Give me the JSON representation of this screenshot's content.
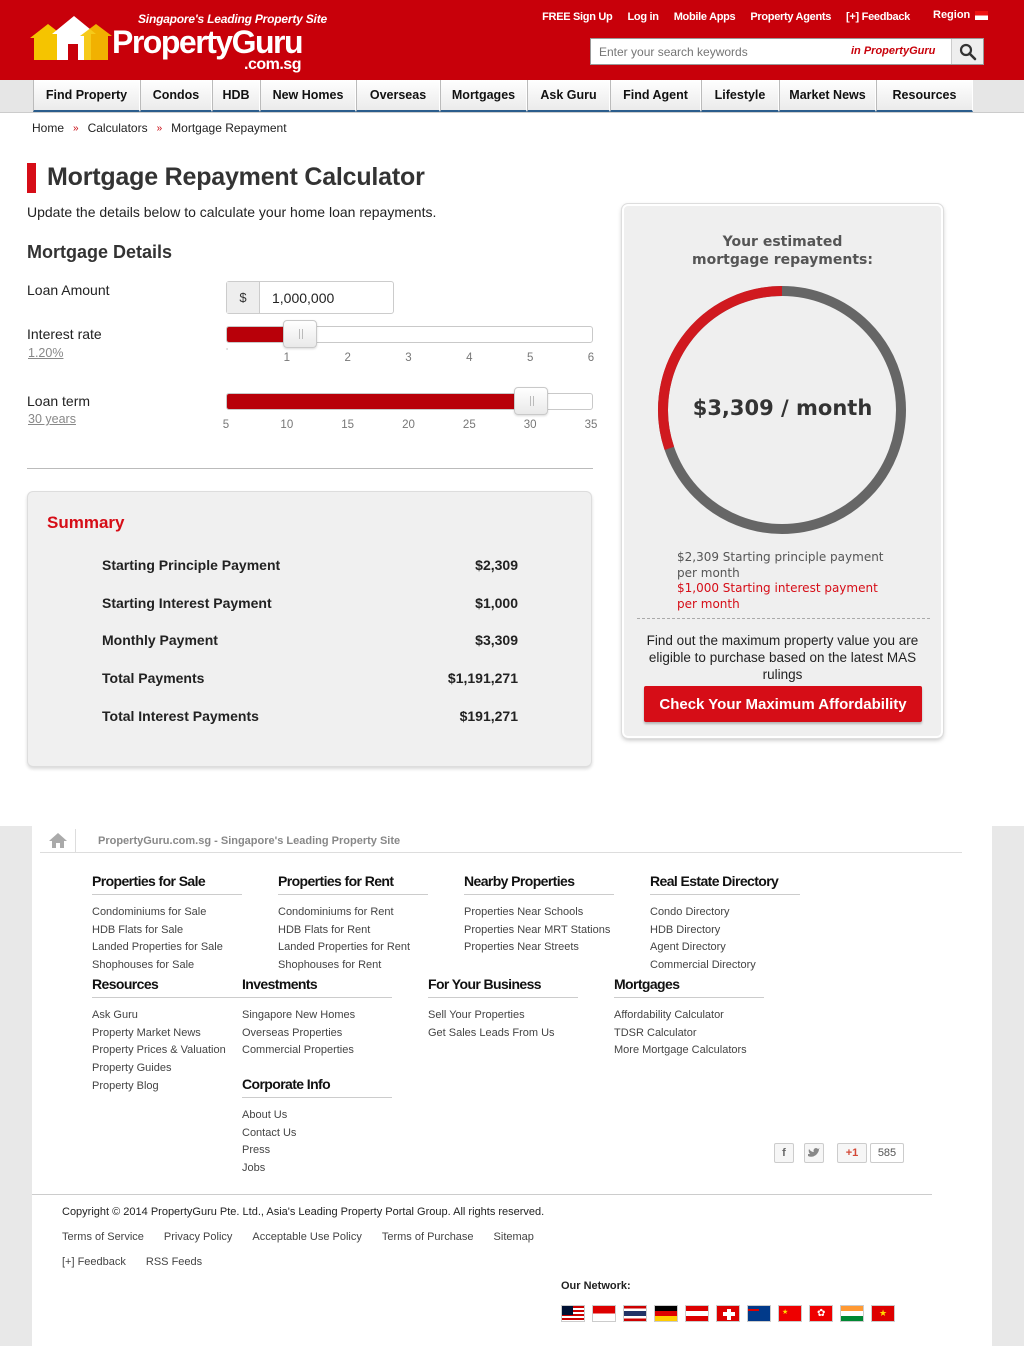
{
  "header": {
    "tagline": "Singapore's Leading Property Site",
    "brand_property": "Property",
    "brand_guru": "Guru",
    "brand_sub": ".com.sg",
    "links": [
      "FREE Sign Up",
      "Log in",
      "Mobile Apps",
      "Property Agents",
      "[+] Feedback"
    ],
    "region": "Region",
    "search_placeholder": "Enter your search keywords",
    "search_scope": "in PropertyGuru"
  },
  "nav": [
    "Find Property",
    "Condos",
    "HDB",
    "New Homes",
    "Overseas",
    "Mortgages",
    "Ask Guru",
    "Find Agent",
    "Lifestyle",
    "Market News",
    "Resources"
  ],
  "breadcrumb": [
    "Home",
    "Calculators",
    "Mortgage Repayment"
  ],
  "breadcrumb_sep": "»",
  "page": {
    "title": "Mortgage Repayment Calculator",
    "subtitle": "Update the details below to calculate your home loan repayments.",
    "section": "Mortgage Details"
  },
  "form": {
    "loan_amount_label": "Loan Amount",
    "currency": "$",
    "loan_amount_value": "1,000,000",
    "interest_label": "Interest rate",
    "interest_value_text": "1.20%",
    "interest_rate": 1.2,
    "interest_ticks": [
      "1",
      "2",
      "3",
      "4",
      "5",
      "6"
    ],
    "interest_min": 0,
    "interest_max": 6,
    "term_label": "Loan term",
    "term_value_text": "30 years",
    "term_years": 30,
    "term_ticks": [
      "5",
      "10",
      "15",
      "20",
      "25",
      "30",
      "35"
    ],
    "term_min": 5,
    "term_max": 35
  },
  "summary": {
    "title": "Summary",
    "rows": [
      {
        "label": "Starting Principle Payment",
        "value": "$2,309"
      },
      {
        "label": "Starting Interest Payment",
        "value": "$1,000"
      },
      {
        "label": "Monthly Payment",
        "value": "$3,309"
      },
      {
        "label": "Total Payments",
        "value": "$1,191,271"
      },
      {
        "label": "Total Interest Payments",
        "value": "$191,271"
      }
    ]
  },
  "result": {
    "heading": "Your estimated mortgage repayments:",
    "monthly": "$3,309 / month",
    "principal_line": "$2,309 Starting principle payment per month",
    "interest_line": "$1,000 Starting interest payment per month",
    "principal": 2309,
    "interest": 1000,
    "colors": {
      "principal": "#666666",
      "interest": "#d0191f"
    },
    "find_text": "Find out the maximum property value you are eligible to purchase based on the latest MAS rulings",
    "cta": "Check Your Maximum Affordability"
  },
  "footer": {
    "site_text": "PropertyGuru.com.sg - Singapore's Leading Property Site",
    "columns": [
      {
        "title": "Properties for Sale",
        "links": [
          "Condominiums for Sale",
          "HDB Flats for Sale",
          "Landed Properties for Sale",
          "Shophouses for Sale"
        ]
      },
      {
        "title": "Properties for Rent",
        "links": [
          "Condominiums for Rent",
          "HDB Flats for Rent",
          "Landed Properties for Rent",
          "Shophouses for Rent"
        ]
      },
      {
        "title": "Nearby Properties",
        "links": [
          "Properties Near Schools",
          "Properties Near MRT Stations",
          "Properties Near Streets"
        ]
      },
      {
        "title": "Real Estate Directory",
        "links": [
          "Condo Directory",
          "HDB Directory",
          "Agent Directory",
          "Commercial Directory"
        ]
      },
      {
        "title": "Resources",
        "links": [
          "Ask Guru",
          "Property Market News",
          "Property Prices & Valuation",
          "Property Guides",
          "Property Blog"
        ]
      },
      {
        "title": "Investments",
        "links": [
          "Singapore New Homes",
          "Overseas Properties",
          "Commercial Properties"
        ]
      },
      {
        "title": "For Your Business",
        "links": [
          "Sell Your Properties",
          "Get Sales Leads From Us"
        ]
      },
      {
        "title": "Mortgages",
        "links": [
          "Affordability Calculator",
          "TDSR Calculator",
          "More Mortgage Calculators"
        ]
      },
      {
        "title": "Corporate Info",
        "links": [
          "About Us",
          "Contact Us",
          "Press",
          "Jobs"
        ]
      }
    ],
    "gplus_label": "+1",
    "gplus_count": "585",
    "copyright": "Copyright © 2014 PropertyGuru Pte. Ltd., Asia's Leading Property Portal Group. All rights reserved.",
    "links": [
      "Terms of Service",
      "Privacy Policy",
      "Acceptable Use Policy",
      "Terms of Purchase",
      "Sitemap"
    ],
    "links2": [
      "[+] Feedback",
      "RSS Feeds"
    ],
    "network": "Our Network:"
  }
}
